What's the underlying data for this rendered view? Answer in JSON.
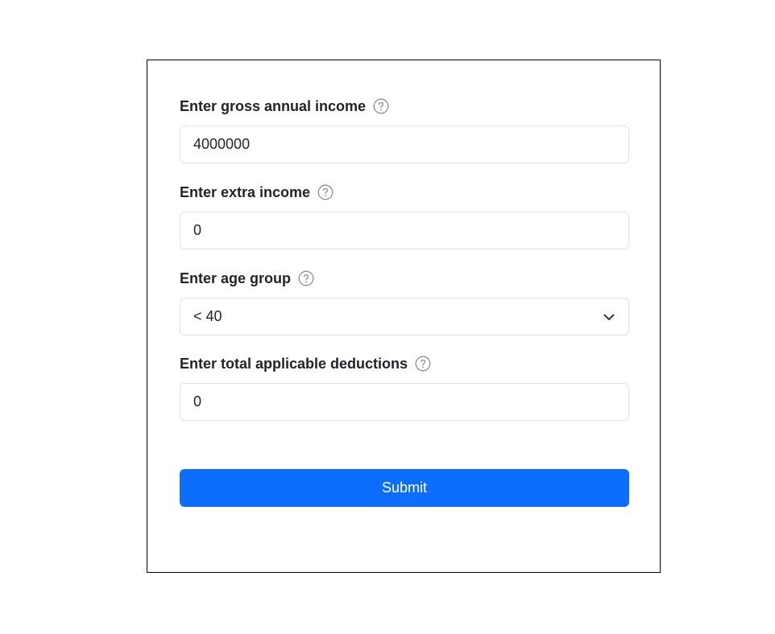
{
  "form": {
    "fields": [
      {
        "label": "Enter gross annual income",
        "value": "4000000",
        "icon": "question-circle-icon"
      },
      {
        "label": "Enter extra income",
        "value": "0",
        "icon": "question-circle-icon"
      },
      {
        "label": "Enter age group",
        "value": "< 40",
        "icon": "question-circle-icon",
        "control": "select",
        "control_icon": "chevron-down-icon"
      },
      {
        "label": "Enter total applicable deductions",
        "value": "0",
        "icon": "question-circle-icon"
      }
    ],
    "submit_label": "Submit"
  },
  "colors": {
    "primary": "#0d6efd",
    "border": "#dee2e6",
    "text": "#212529",
    "icon": "#8a8f94"
  }
}
